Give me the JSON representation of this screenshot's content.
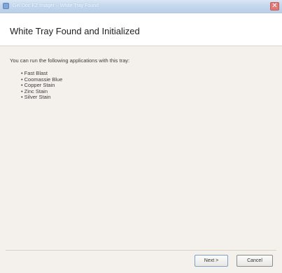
{
  "window": {
    "title": "Gel Doc EZ Imager – White Tray Found",
    "close_glyph": "✕"
  },
  "header": {
    "title": "White Tray Found and Initialized"
  },
  "content": {
    "intro": "You can run the following applications with this tray:",
    "applications": [
      "Fast Blast",
      "Coomassie Blue",
      "Copper Stain",
      "Zinc Stain",
      "Silver Stain"
    ]
  },
  "buttons": {
    "next": "Next >",
    "cancel": "Cancel"
  },
  "colors": {
    "titlebar": "#c5d8ee",
    "body_bg": "#f4f1ec",
    "close": "#e07a78"
  },
  "icons": {
    "app": "app-icon",
    "close": "close-icon"
  }
}
